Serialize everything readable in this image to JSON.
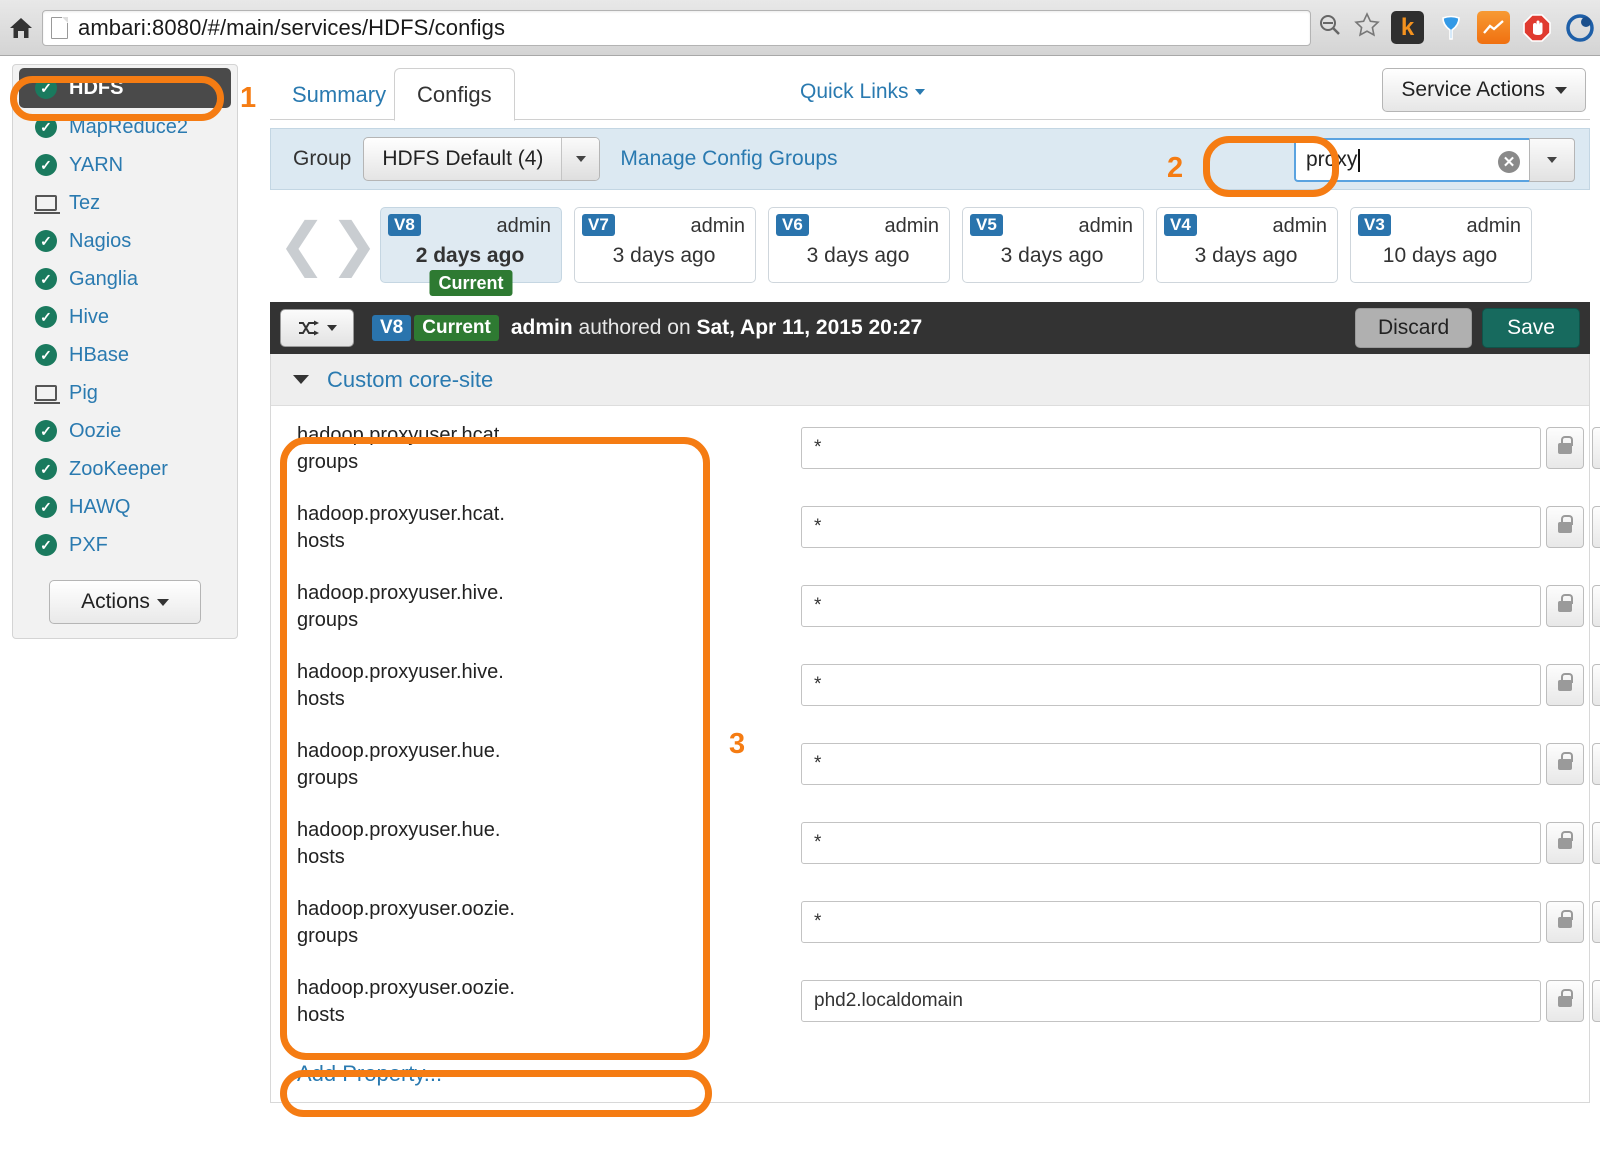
{
  "browser": {
    "url": "ambari:8080/#/main/services/HDFS/configs",
    "home_icon": "home-icon",
    "page_icon": "page-file-icon",
    "zoom_out_icon": "zoom-out-icon",
    "bookmark_icon": "star-icon",
    "extensions": [
      {
        "name": "kontera-extension-icon",
        "glyph": "k"
      },
      {
        "name": "funnel-extension-icon",
        "glyph": "▼"
      },
      {
        "name": "analytics-extension-icon",
        "glyph": "▲"
      },
      {
        "name": "adblock-extension-icon",
        "glyph": "✋"
      },
      {
        "name": "ghostery-extension-icon",
        "glyph": "◐"
      }
    ]
  },
  "sidebar": {
    "items": [
      {
        "label": "HDFS",
        "icon": "status-ok-icon",
        "active": true
      },
      {
        "label": "MapReduce2",
        "icon": "status-ok-icon",
        "active": false
      },
      {
        "label": "YARN",
        "icon": "status-ok-icon",
        "active": false
      },
      {
        "label": "Tez",
        "icon": "monitor-icon",
        "active": false
      },
      {
        "label": "Nagios",
        "icon": "status-ok-icon",
        "active": false
      },
      {
        "label": "Ganglia",
        "icon": "status-ok-icon",
        "active": false
      },
      {
        "label": "Hive",
        "icon": "status-ok-icon",
        "active": false
      },
      {
        "label": "HBase",
        "icon": "status-ok-icon",
        "active": false
      },
      {
        "label": "Pig",
        "icon": "monitor-icon",
        "active": false
      },
      {
        "label": "Oozie",
        "icon": "status-ok-icon",
        "active": false
      },
      {
        "label": "ZooKeeper",
        "icon": "status-ok-icon",
        "active": false
      },
      {
        "label": "HAWQ",
        "icon": "status-ok-icon",
        "active": false
      },
      {
        "label": "PXF",
        "icon": "status-ok-icon",
        "active": false
      }
    ],
    "actions_button": "Actions"
  },
  "tabs": {
    "summary": "Summary",
    "configs": "Configs",
    "quick_links": "Quick Links",
    "service_actions": "Service Actions"
  },
  "group_bar": {
    "label": "Group",
    "selected_group": "HDFS Default (4)",
    "manage_link": "Manage Config Groups"
  },
  "filter": {
    "value": "proxy",
    "placeholder": "",
    "clear_icon": "clear-icon",
    "dropdown_icon": "chevron-down-icon"
  },
  "versions": {
    "prev_icon": "chevron-left-icon",
    "next_icon": "chevron-right-icon",
    "cards": [
      {
        "version": "V8",
        "author": "admin",
        "time": "2 days ago",
        "current": true,
        "badge": "Current"
      },
      {
        "version": "V7",
        "author": "admin",
        "time": "3 days ago",
        "current": false,
        "badge": ""
      },
      {
        "version": "V6",
        "author": "admin",
        "time": "3 days ago",
        "current": false,
        "badge": ""
      },
      {
        "version": "V5",
        "author": "admin",
        "time": "3 days ago",
        "current": false,
        "badge": ""
      },
      {
        "version": "V4",
        "author": "admin",
        "time": "3 days ago",
        "current": false,
        "badge": ""
      },
      {
        "version": "V3",
        "author": "admin",
        "time": "10 days ago",
        "current": false,
        "badge": ""
      }
    ]
  },
  "toolbar": {
    "compare_icon": "compare-shuffle-icon",
    "version": "V8",
    "current_badge": "Current",
    "authored_prefix": "admin",
    "authored_mid": " authored on ",
    "authored_date": "Sat, Apr 11, 2015 20:27",
    "discard_label": "Discard",
    "save_label": "Save"
  },
  "section": {
    "title": "Custom core-site",
    "collapse_icon": "caret-down-icon",
    "add_property": "Add Property..."
  },
  "properties": [
    {
      "name": "hadoop.proxyuser.hcat.groups",
      "value": "*"
    },
    {
      "name": "hadoop.proxyuser.hcat.hosts",
      "value": "*"
    },
    {
      "name": "hadoop.proxyuser.hive.groups",
      "value": "*"
    },
    {
      "name": "hadoop.proxyuser.hive.hosts",
      "value": "*"
    },
    {
      "name": "hadoop.proxyuser.hue.groups",
      "value": "*"
    },
    {
      "name": "hadoop.proxyuser.hue.hosts",
      "value": "*"
    },
    {
      "name": "hadoop.proxyuser.oozie.groups",
      "value": "*"
    },
    {
      "name": "hadoop.proxyuser.oozie.hosts",
      "value": "phd2.localdomain"
    }
  ],
  "row_buttons": {
    "lock_icon": "lock-icon",
    "add_icon": "plus-circle-icon",
    "remove_icon": "minus-circle-icon"
  },
  "annotations": {
    "color": "#f57c13",
    "one": "1",
    "two": "2",
    "three": "3"
  }
}
